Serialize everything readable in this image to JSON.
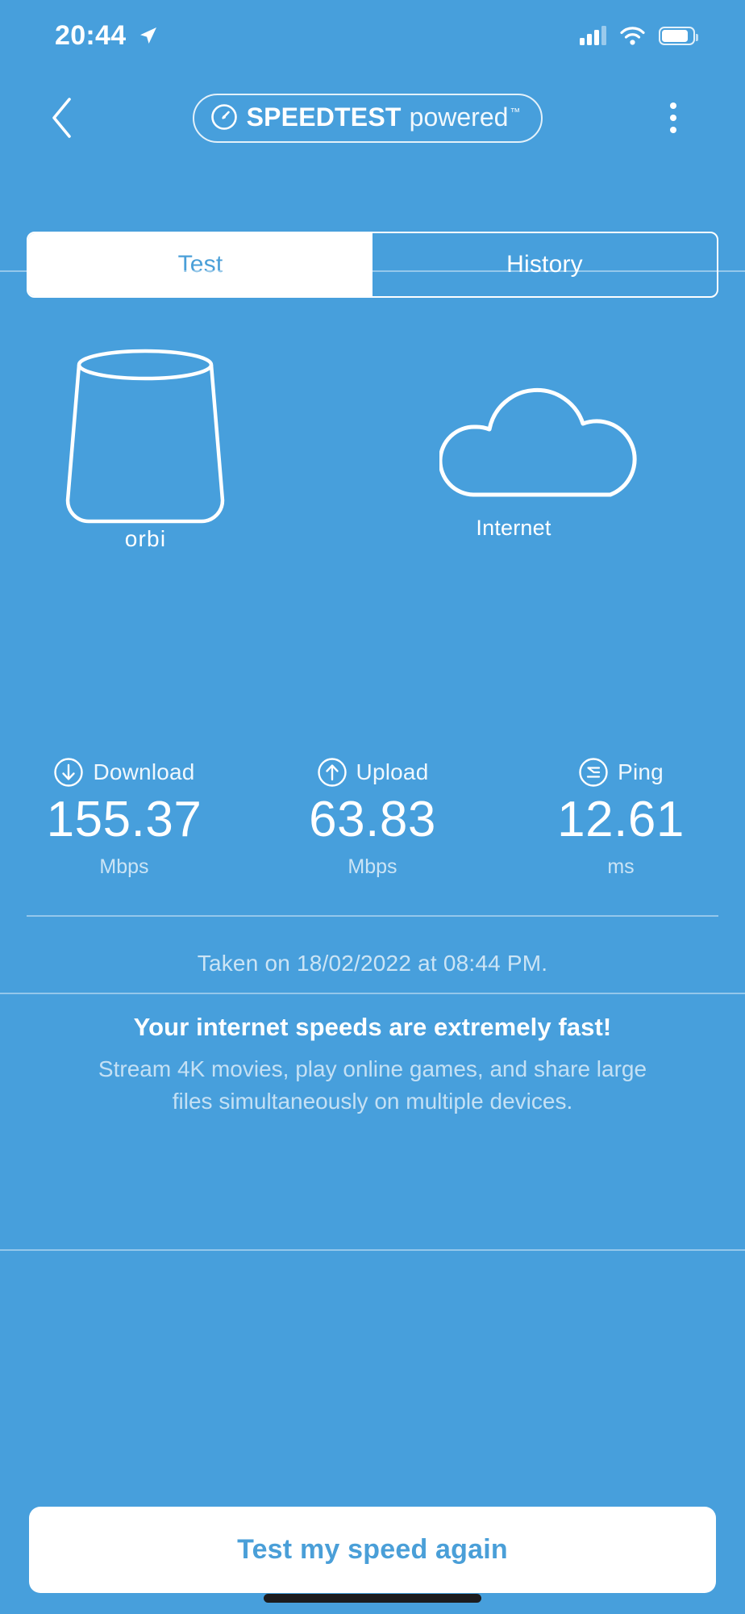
{
  "status_bar": {
    "time": "20:44",
    "location_icon": "location-arrow-icon",
    "signal_icon": "cellular-signal-icon",
    "wifi_icon": "wifi-icon",
    "battery_icon": "battery-icon"
  },
  "header": {
    "back_icon": "chevron-left-icon",
    "logo_icon": "speedtest-gauge-icon",
    "logo_bold": "SPEEDTEST",
    "logo_light": "powered",
    "logo_tm": "™",
    "menu_icon": "kebab-menu-icon"
  },
  "tabs": {
    "items": [
      {
        "label": "Test",
        "active": true
      },
      {
        "label": "History",
        "active": false
      }
    ]
  },
  "illustration": {
    "router_icon": "orbi-router-icon",
    "router_label": "orbi",
    "cloud_icon": "cloud-icon",
    "cloud_label": "Internet"
  },
  "metrics": [
    {
      "icon": "arrow-down-circle-icon",
      "label": "Download",
      "value": "155.37",
      "unit": "Mbps"
    },
    {
      "icon": "arrow-up-circle-icon",
      "label": "Upload",
      "value": "63.83",
      "unit": "Mbps"
    },
    {
      "icon": "ping-circle-icon",
      "label": "Ping",
      "value": "12.61",
      "unit": "ms"
    }
  ],
  "taken_on": "Taken on 18/02/2022 at 08:44 PM.",
  "message": {
    "title": "Your internet speeds are extremely fast!",
    "description": "Stream 4K movies, play online games, and share large files simultaneously on multiple devices."
  },
  "cta": {
    "label": "Test my speed again"
  },
  "colors": {
    "background": "#479fdc",
    "accent_text": "#4a9fd8",
    "on_background": "#ffffff"
  }
}
